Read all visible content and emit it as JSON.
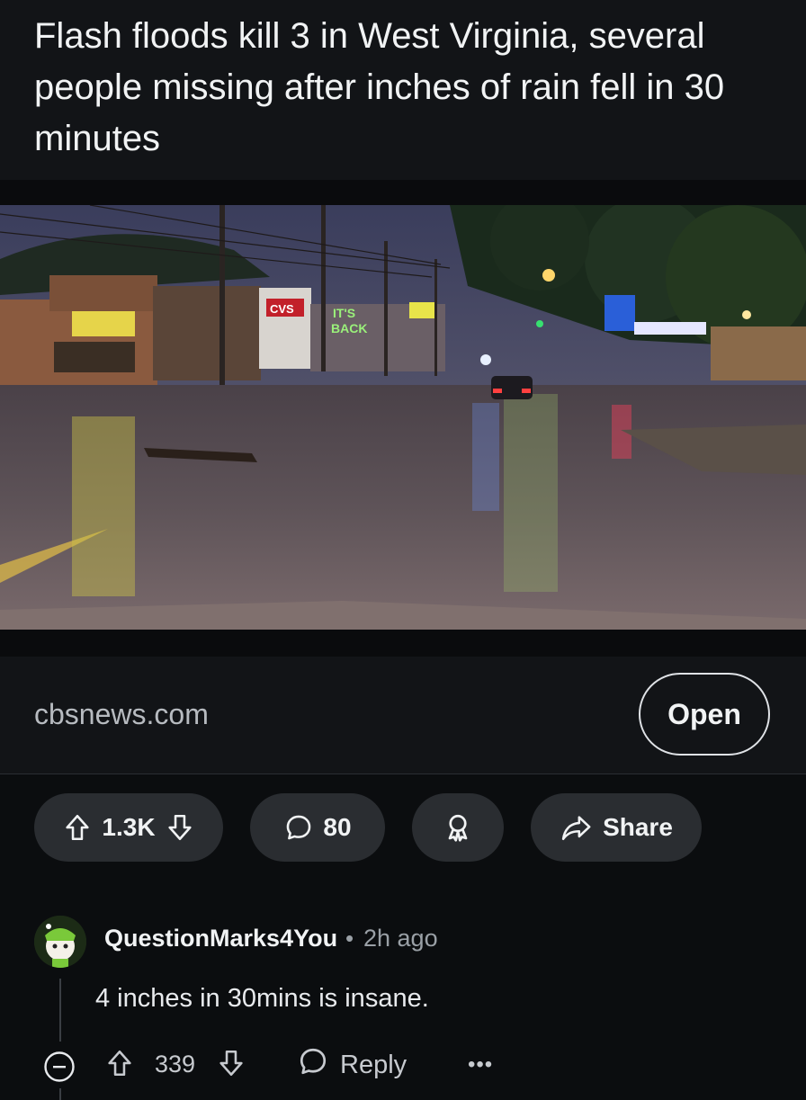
{
  "post": {
    "title": "Flash floods kill 3 in West Virginia, several people missing after inches of rain fell in 30 minutes",
    "image_alt": "Flooded street at dusk with CVS and store signs reflecting in the water",
    "link": {
      "domain": "cbsnews.com",
      "open_label": "Open"
    },
    "actions": {
      "score": "1.3K",
      "comments_count": "80",
      "share_label": "Share"
    }
  },
  "comment": {
    "username": "QuestionMarks4You",
    "separator": "•",
    "age": "2h ago",
    "body": "4 inches in 30mins is insane.",
    "score": "339",
    "reply_label": "Reply",
    "more_label": "•••"
  },
  "colors": {
    "background": "#0b0d0f",
    "card": "#121417",
    "pill": "#2a2d31",
    "text_primary": "#f1f3f4",
    "text_secondary": "#9aa0a6"
  }
}
